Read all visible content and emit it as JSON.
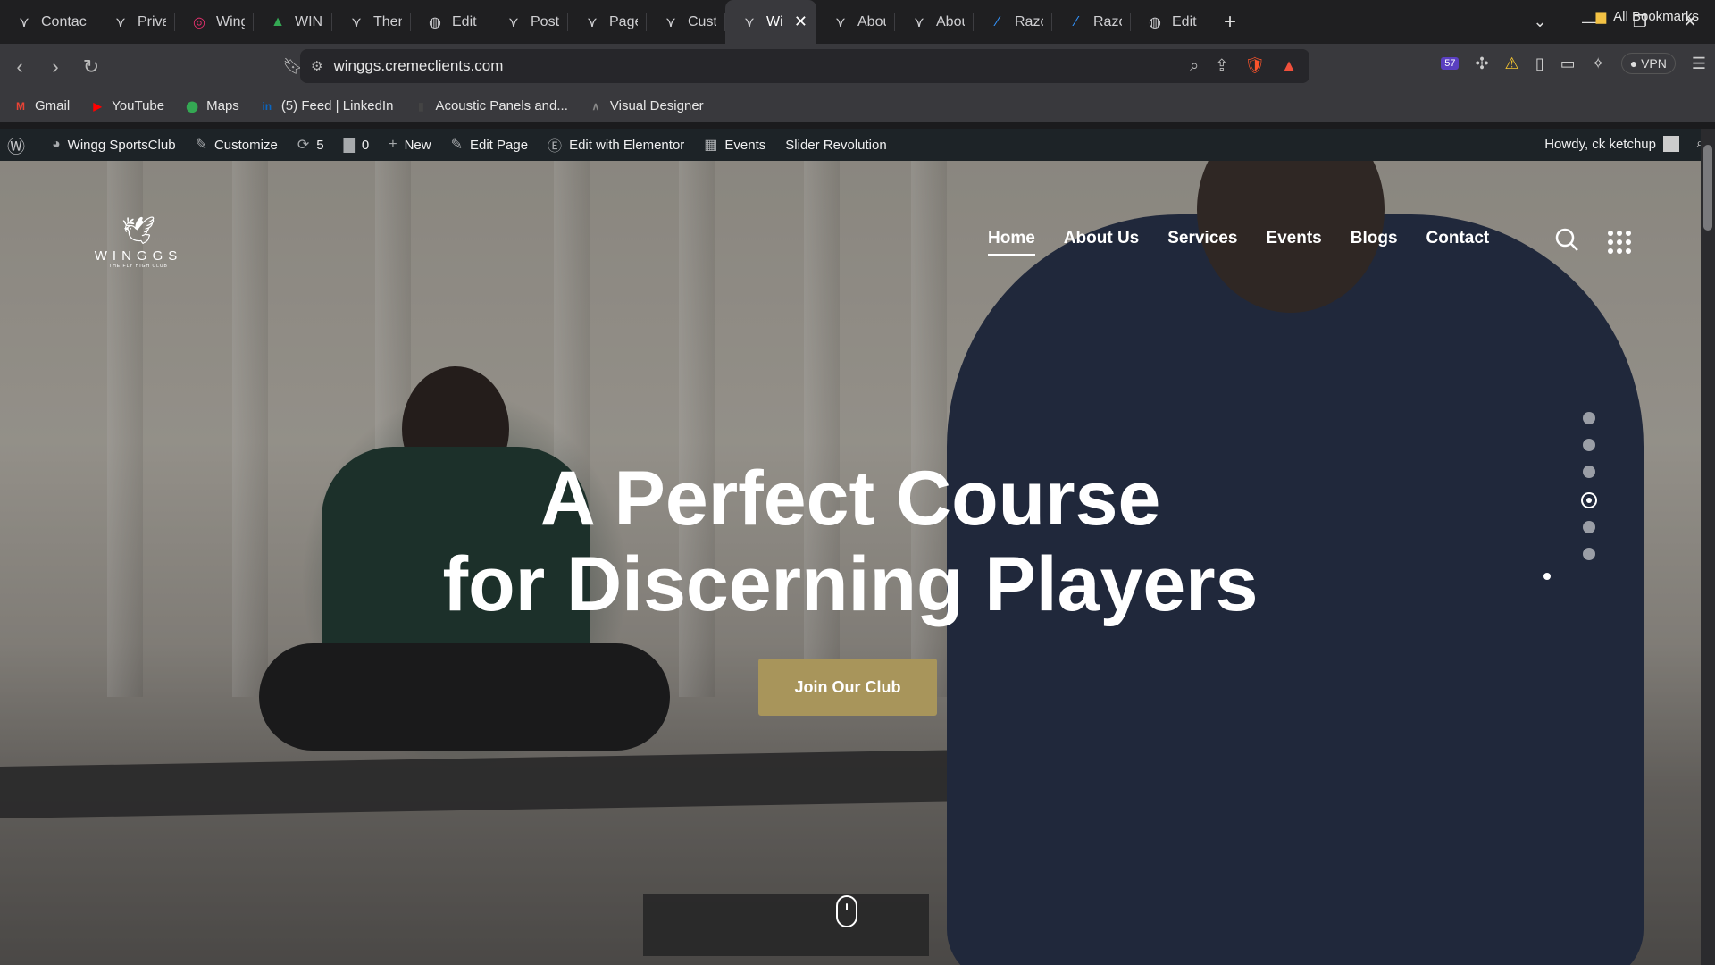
{
  "browser": {
    "tabs": [
      {
        "title": "Contac",
        "icon": "wingg-favicon"
      },
      {
        "title": "Privacy",
        "icon": "wingg-favicon"
      },
      {
        "title": "Wingg",
        "icon": "instagram-favicon"
      },
      {
        "title": "WINGG",
        "icon": "google-drive-favicon"
      },
      {
        "title": "Theme",
        "icon": "wingg-favicon"
      },
      {
        "title": "Edit \"H",
        "icon": "globe-favicon"
      },
      {
        "title": "Posts",
        "icon": "wingg-favicon"
      },
      {
        "title": "Pages",
        "icon": "wingg-favicon"
      },
      {
        "title": "Custon",
        "icon": "wingg-favicon"
      },
      {
        "title": "Wi",
        "icon": "wingg-favicon",
        "active": true
      },
      {
        "title": "About",
        "icon": "wingg-favicon"
      },
      {
        "title": "About",
        "icon": "wingg-favicon"
      },
      {
        "title": "Razorp",
        "icon": "razorpay-favicon"
      },
      {
        "title": "Razorp",
        "icon": "razorpay-favicon"
      },
      {
        "title": "Edit pr",
        "icon": "globe-favicon"
      }
    ],
    "url": "winggs.cremeclients.com",
    "extension_badge": "57",
    "brave_badge": "1",
    "vpn_label": "VPN",
    "bookmarks": [
      {
        "label": "Gmail",
        "icon": "gmail-icon"
      },
      {
        "label": "YouTube",
        "icon": "youtube-icon"
      },
      {
        "label": "Maps",
        "icon": "maps-icon"
      },
      {
        "label": "(5) Feed | LinkedIn",
        "icon": "linkedin-icon"
      },
      {
        "label": "Acoustic Panels and...",
        "icon": "page-icon"
      },
      {
        "label": "Visual Designer",
        "icon": "visual-designer-icon"
      }
    ],
    "all_bookmarks": "All Bookmarks"
  },
  "wp_admin_bar": {
    "site_name": "Wingg SportsClub",
    "customize": "Customize",
    "updates": "5",
    "comments": "0",
    "new": "New",
    "edit_page": "Edit Page",
    "edit_elementor": "Edit with Elementor",
    "events": "Events",
    "slider_revolution": "Slider Revolution",
    "howdy": "Howdy, ck ketchup"
  },
  "site": {
    "logo_name": "WINGGS",
    "logo_tagline": "THE FLY HIGH CLUB",
    "nav": [
      "Home",
      "About Us",
      "Services",
      "Events",
      "Blogs",
      "Contact"
    ],
    "active_nav": "Home",
    "headline_line1": "A Perfect Course",
    "headline_line2": "for Discerning Players",
    "cta": "Join Our Club",
    "accent_color": "#a8955b",
    "slider_total": 6,
    "slider_active": 4
  }
}
